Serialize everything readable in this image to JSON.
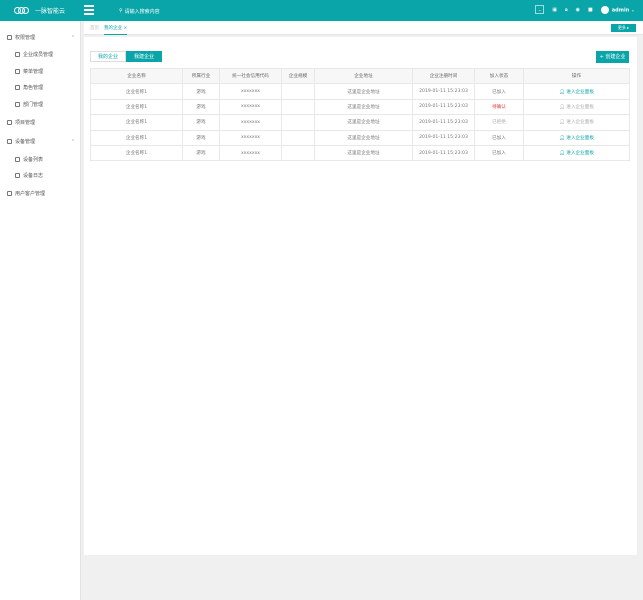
{
  "header": {
    "app_name": "一脉智能云",
    "search_placeholder": "请输入搜索内容",
    "user": "admin"
  },
  "sidebar": [
    {
      "label": "权限管理",
      "level": 1,
      "expanded": true
    },
    {
      "label": "企业成员管理",
      "level": 2
    },
    {
      "label": "菜单管理",
      "level": 2
    },
    {
      "label": "角色管理",
      "level": 2
    },
    {
      "label": "部门管理",
      "level": 2
    },
    {
      "label": "项目管理",
      "level": 1
    },
    {
      "label": "设备管理",
      "level": 1,
      "expanded": true
    },
    {
      "label": "设备列表",
      "level": 2
    },
    {
      "label": "设备日志",
      "level": 2
    },
    {
      "label": "用户客户管理",
      "level": 1
    }
  ],
  "tabs": {
    "home": "首页",
    "current": "我的企业",
    "close": "×",
    "more": "更多 ▸"
  },
  "segment": {
    "mine": "我的企业",
    "created": "我建企业"
  },
  "new_button": "+ 创建企业",
  "accent": "#0aa5a8",
  "table": {
    "headers": [
      "企业名称",
      "所属行业",
      "统一社会信用代码",
      "企业规模",
      "企业地址",
      "企业注册时间",
      "加入状态",
      "操作"
    ],
    "rows": [
      {
        "name": "企业名称1",
        "industry": "游戏",
        "code": "xxxxxxx",
        "scale": "",
        "address": "这里是企业地址",
        "time": "2019-01-11 15:23:03",
        "status": "已加入",
        "status_type": "normal",
        "action": "进入企业面板",
        "action_enabled": true
      },
      {
        "name": "企业名称1",
        "industry": "游戏",
        "code": "xxxxxxx",
        "scale": "",
        "address": "这里是企业地址",
        "time": "2019-01-11 15:23:03",
        "status": "待确认",
        "status_type": "warning",
        "action": "进入企业面板",
        "action_enabled": false
      },
      {
        "name": "企业名称1",
        "industry": "游戏",
        "code": "xxxxxxx",
        "scale": "",
        "address": "这里是企业地址",
        "time": "2019-01-11 15:23:03",
        "status": "已拒绝",
        "status_type": "muted",
        "action": "进入企业面板",
        "action_enabled": false
      },
      {
        "name": "企业名称1",
        "industry": "游戏",
        "code": "xxxxxxx",
        "scale": "",
        "address": "这里是企业地址",
        "time": "2019-01-11 15:23:03",
        "status": "已加入",
        "status_type": "normal",
        "action": "进入企业面板",
        "action_enabled": true
      },
      {
        "name": "企业名称1",
        "industry": "游戏",
        "code": "xxxxxxx",
        "scale": "",
        "address": "这里是企业地址",
        "time": "2019-01-11 15:23:03",
        "status": "已加入",
        "status_type": "normal",
        "action": "进入企业面板",
        "action_enabled": true
      }
    ]
  }
}
